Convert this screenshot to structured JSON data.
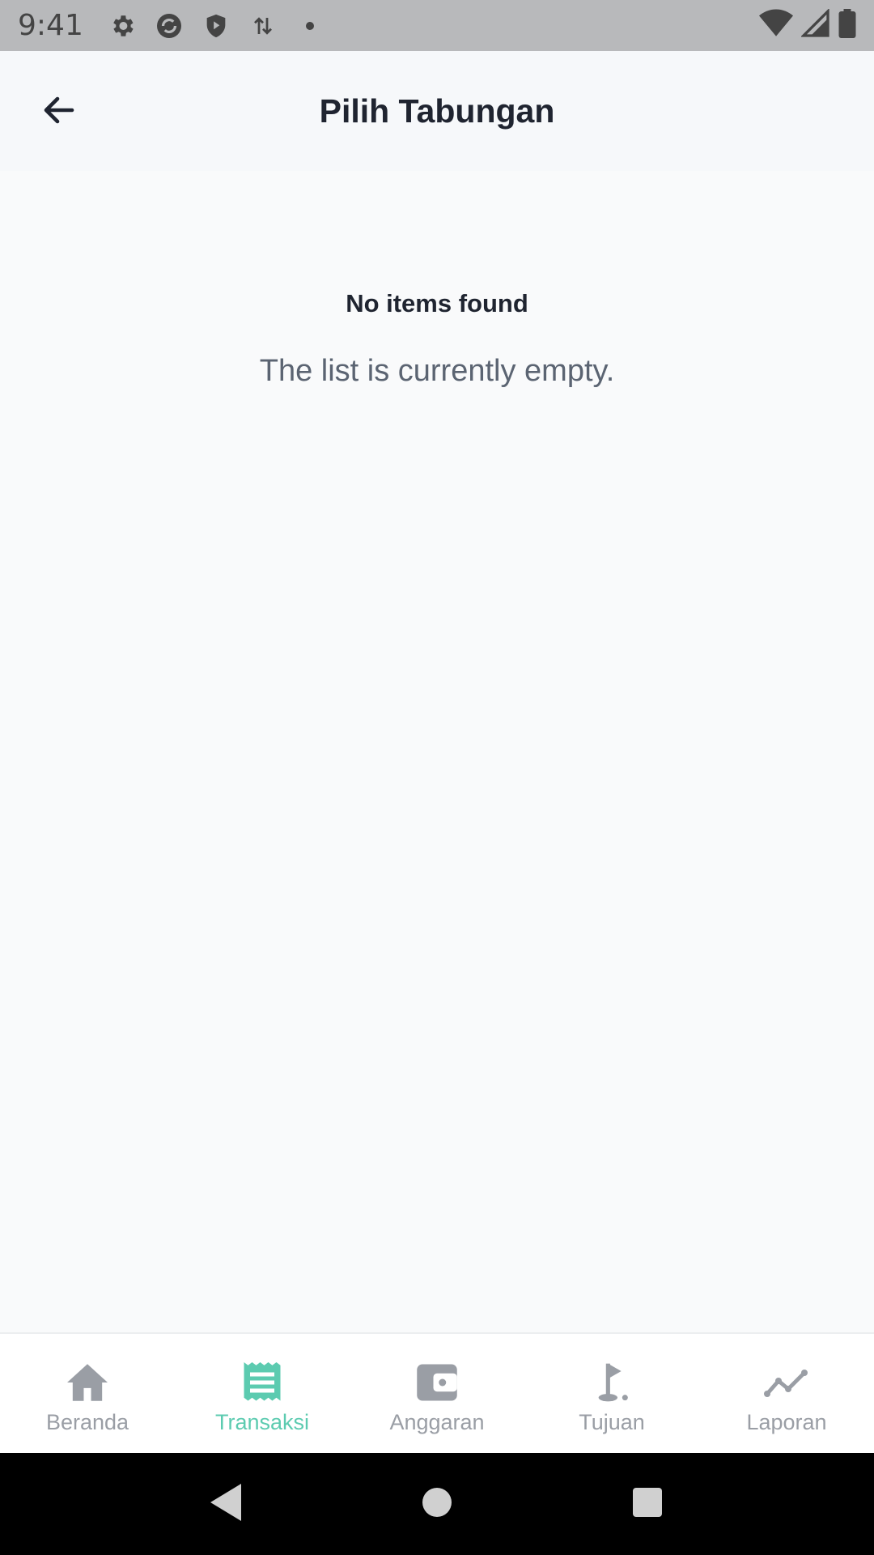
{
  "status_bar": {
    "time": "9:41",
    "icons": [
      "gear-icon",
      "sync-icon",
      "shield-play-icon",
      "data-arrows-icon",
      "dot-icon"
    ],
    "right_icons": [
      "wifi-icon",
      "signal-icon",
      "battery-icon"
    ]
  },
  "app_bar": {
    "title": "Pilih Tabungan",
    "back_icon": "arrow-left-icon"
  },
  "empty_state": {
    "title": "No items found",
    "subtitle": "The list is currently empty."
  },
  "bottom_nav": {
    "active_color": "#5ccbb0",
    "inactive_color": "#9a9ea5",
    "items": [
      {
        "label": "Beranda",
        "icon": "home-icon",
        "active": false
      },
      {
        "label": "Transaksi",
        "icon": "receipt-icon",
        "active": true
      },
      {
        "label": "Anggaran",
        "icon": "wallet-icon",
        "active": false
      },
      {
        "label": "Tujuan",
        "icon": "golf-flag-icon",
        "active": false
      },
      {
        "label": "Laporan",
        "icon": "line-chart-icon",
        "active": false
      }
    ]
  },
  "system_nav": {
    "buttons": [
      "back-triangle-icon",
      "home-circle-icon",
      "recents-square-icon"
    ]
  }
}
